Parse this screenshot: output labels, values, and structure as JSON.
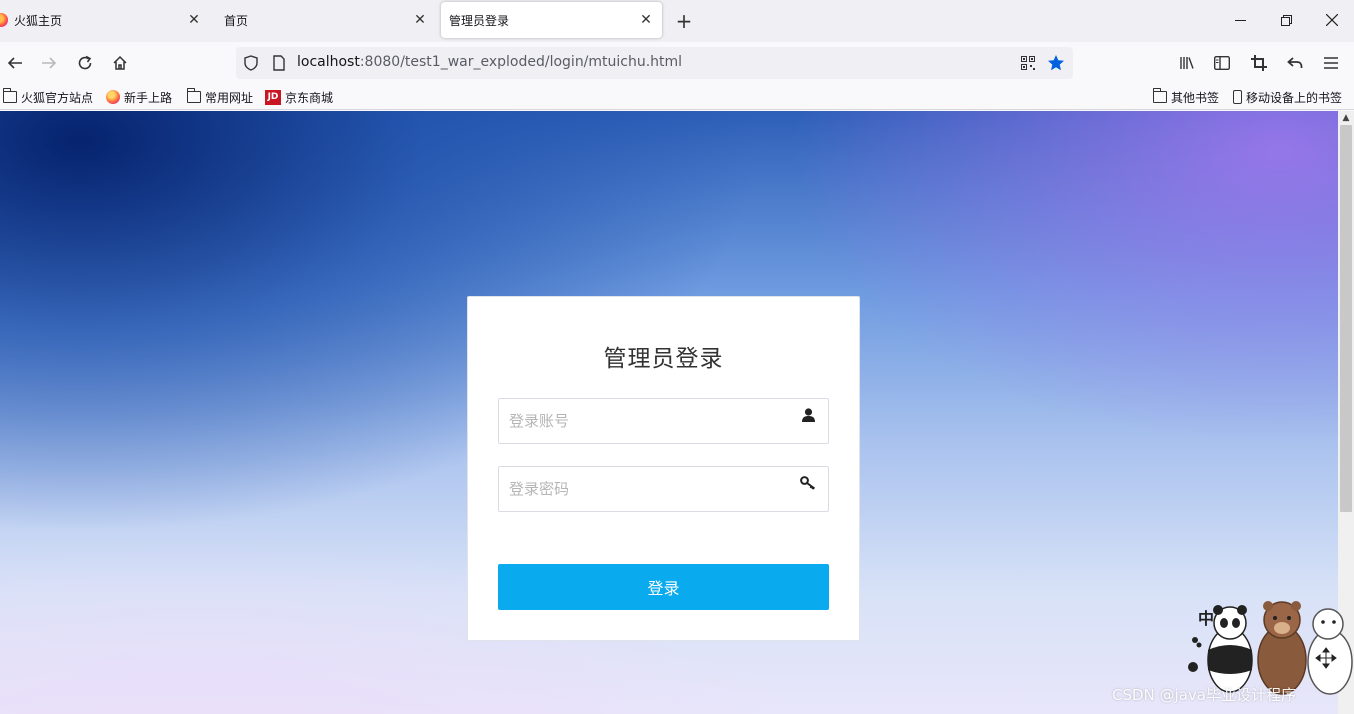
{
  "browser": {
    "tabs": [
      {
        "label": "火狐主页",
        "active": false
      },
      {
        "label": "首页",
        "active": false
      },
      {
        "label": "管理员登录",
        "active": true
      }
    ],
    "url_host": "localhost",
    "url_rest": ":8080/test1_war_exploded/login/mtuichu.html",
    "bookmarks": [
      "火狐官方站点",
      "新手上路",
      "常用网址",
      "京东商城"
    ],
    "bookmarks_right": [
      "其他书签",
      "移动设备上的书签"
    ],
    "jd_icon_text": "JD"
  },
  "login": {
    "title": "管理员登录",
    "username_placeholder": "登录账号",
    "password_placeholder": "登录密码",
    "submit_label": "登录"
  },
  "overlay": {
    "watermark": "CSDN @java毕业设计程序",
    "mascot_char": "中"
  },
  "colors": {
    "primary_button": "#09aaee",
    "card_bg": "#ffffff",
    "bookmark_star": "#0060df"
  }
}
